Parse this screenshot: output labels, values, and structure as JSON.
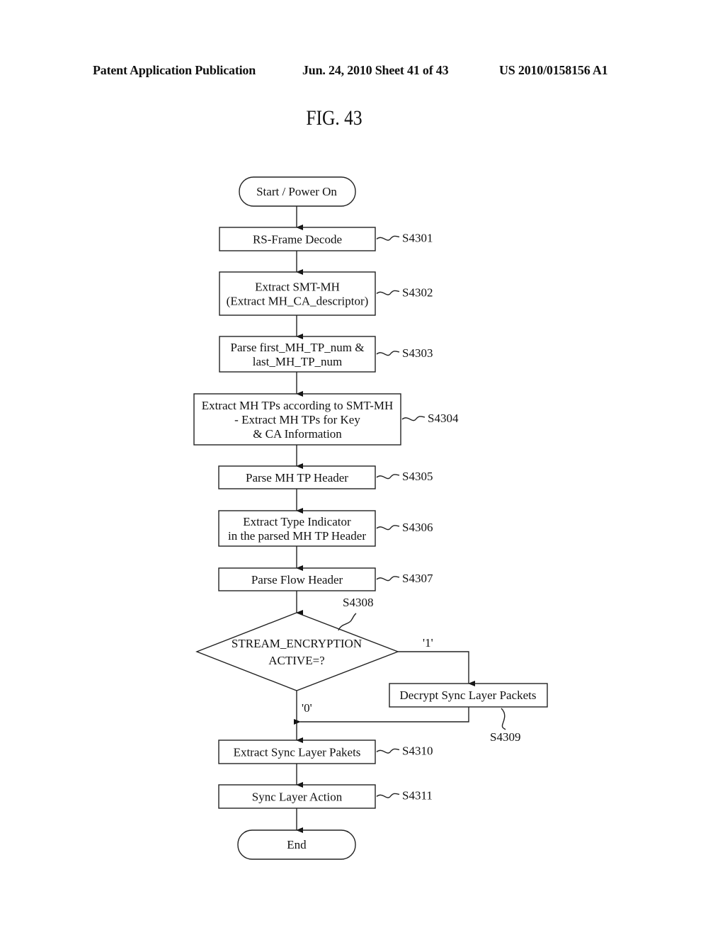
{
  "header": {
    "left": "Patent Application Publication",
    "middle": "Jun. 24, 2010  Sheet 41 of 43",
    "right": "US 2010/0158156 A1"
  },
  "figure": {
    "title": "FIG. 43"
  },
  "flowchart": {
    "start": {
      "text": "Start / Power On"
    },
    "steps": [
      {
        "id": "S4301",
        "lines": [
          "RS-Frame Decode"
        ]
      },
      {
        "id": "S4302",
        "lines": [
          "Extract SMT-MH",
          "(Extract MH_CA_descriptor)"
        ]
      },
      {
        "id": "S4303",
        "lines": [
          "Parse first_MH_TP_num &",
          "last_MH_TP_num"
        ]
      },
      {
        "id": "S4304",
        "lines": [
          "Extract MH TPs according to SMT-MH",
          "- Extract MH TPs for Key",
          "& CA Information"
        ]
      },
      {
        "id": "S4305",
        "lines": [
          "Parse MH TP Header"
        ]
      },
      {
        "id": "S4306",
        "lines": [
          "Extract Type Indicator",
          "in the parsed MH TP Header"
        ]
      },
      {
        "id": "S4307",
        "lines": [
          "Parse Flow Header"
        ]
      }
    ],
    "decision": {
      "id": "S4308",
      "lines": [
        "STREAM_ENCRYPTION",
        "ACTIVE=?"
      ],
      "yes_label": "'1'",
      "no_label": "'0'"
    },
    "branch_step": {
      "id": "S4309",
      "lines": [
        "Decrypt Sync Layer Packets"
      ]
    },
    "after_steps": [
      {
        "id": "S4310",
        "lines": [
          "Extract Sync Layer Pakets"
        ]
      },
      {
        "id": "S4311",
        "lines": [
          "Sync Layer Action"
        ]
      }
    ],
    "end": {
      "text": "End"
    }
  }
}
